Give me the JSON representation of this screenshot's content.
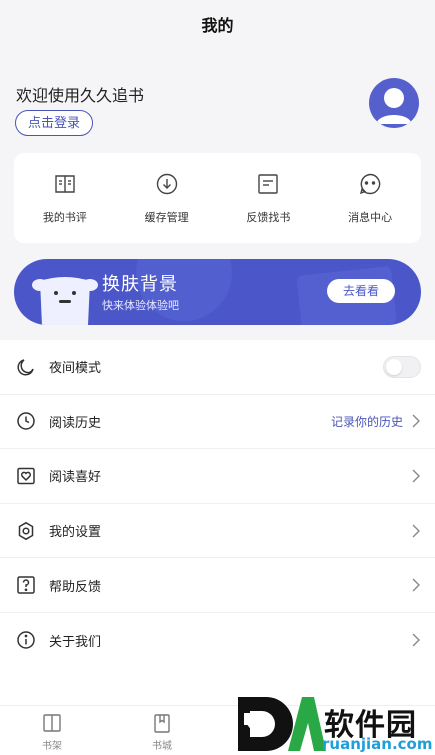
{
  "header": {
    "title": "我的"
  },
  "profile": {
    "welcome": "欢迎使用久久追书",
    "login_label": "点击登录",
    "avatar_icon": "user-avatar-icon"
  },
  "quick_actions": [
    {
      "label": "我的书评",
      "icon": "book-review-icon"
    },
    {
      "label": "缓存管理",
      "icon": "download-icon"
    },
    {
      "label": "反馈找书",
      "icon": "feedback-icon"
    },
    {
      "label": "消息中心",
      "icon": "message-icon"
    }
  ],
  "banner": {
    "title": "换肤背景",
    "subtitle": "快来体验体验吧",
    "button_label": "去看看",
    "color": "#4b57c9"
  },
  "menu": [
    {
      "label": "夜间模式",
      "icon": "moon-icon",
      "type": "toggle",
      "on": false
    },
    {
      "label": "阅读历史",
      "icon": "clock-icon",
      "extra": "记录你的历史"
    },
    {
      "label": "阅读喜好",
      "icon": "heart-box-icon"
    },
    {
      "label": "我的设置",
      "icon": "gear-icon"
    },
    {
      "label": "帮助反馈",
      "icon": "question-icon"
    },
    {
      "label": "关于我们",
      "icon": "info-icon"
    }
  ],
  "tabs": [
    {
      "label": "书架",
      "icon": "bookshelf-icon"
    },
    {
      "label": "书城",
      "icon": "bookstore-icon"
    }
  ],
  "watermark": {
    "brand": "软件园",
    "url": "ruanjian.com"
  },
  "colors": {
    "accent": "#4a55b8",
    "background": "#f5f5f7"
  }
}
